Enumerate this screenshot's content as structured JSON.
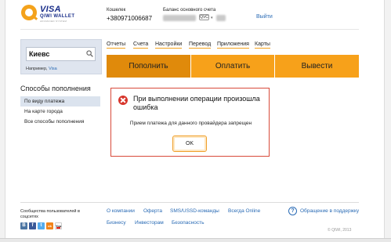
{
  "header": {
    "logo": {
      "brand": "VISA",
      "product": "QIWI WALLET",
      "tagline": "ADVANCED SYSTEM"
    },
    "wallet_label": "Кошелек",
    "wallet_number": "+380971006687",
    "balance_label": "Баланс основного счета",
    "currency": "QVC",
    "logout": "Выйти"
  },
  "search": {
    "value": "Киевс",
    "hint_prefix": "Например,",
    "hint_example": "Visa"
  },
  "topnav": {
    "items": [
      "Отчеты",
      "Счета",
      "Настройки",
      "Перевод",
      "Приложения",
      "Карты"
    ]
  },
  "tabs": {
    "items": [
      "Пополнить",
      "Оплатить",
      "Вывести"
    ],
    "active_index": 0
  },
  "methods": {
    "title": "Способы пополнения",
    "items": [
      "По виду платежа",
      "На карте города",
      "Все способы пополнения"
    ],
    "active_index": 0
  },
  "dialog": {
    "title": "При выполнении операции произошла ошибка",
    "message": "Прием платежа для данного провайдера запрещен",
    "ok_label": "OK"
  },
  "footer": {
    "community": "Сообщества пользователей в соцсетях",
    "socials": [
      "В",
      "f",
      "t",
      "ok",
      "You"
    ],
    "links_row1": [
      "О компании",
      "Оферта",
      "SMS/USSD-команды",
      "Всегда Online"
    ],
    "links_row2": [
      "Бизнесу",
      "Инвесторам",
      "Безопасность"
    ],
    "help_link": "Обращение в поддержку",
    "copyright": "© QIWI, 2013"
  },
  "colors": {
    "accent": "#f7a11a",
    "accent_active": "#e08a0b",
    "link": "#2a6bb5",
    "error": "#d7352b"
  }
}
